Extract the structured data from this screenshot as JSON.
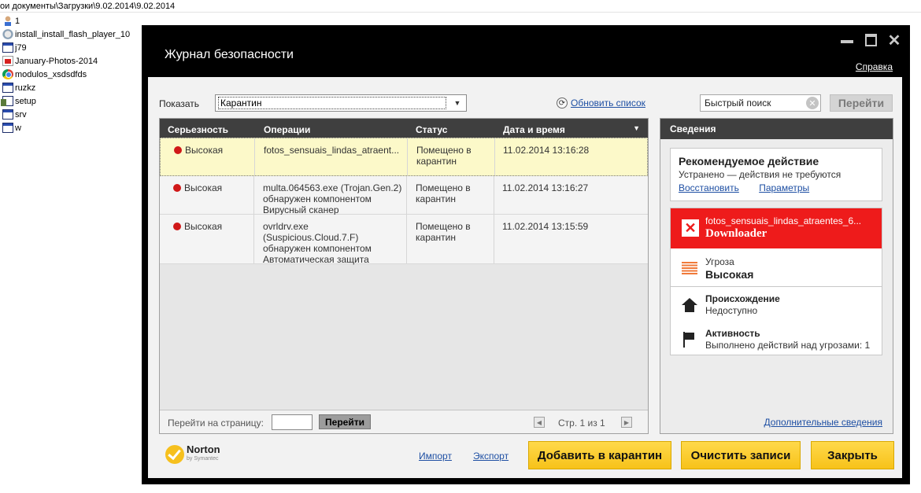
{
  "explorer": {
    "path": "ои документы\\Загрузки\\9.02.2014\\9.02.2014",
    "files": [
      {
        "name": "1",
        "icon": "user-icon"
      },
      {
        "name": "install_install_flash_player_10",
        "icon": "flash-icon"
      },
      {
        "name": "j79",
        "icon": "window-icon"
      },
      {
        "name": "January-Photos-2014",
        "icon": "pdf-icon"
      },
      {
        "name": "modulos_xsdsdfds",
        "icon": "chrome-icon"
      },
      {
        "name": "ruzkz",
        "icon": "window-icon"
      },
      {
        "name": "setup",
        "icon": "setup-icon"
      },
      {
        "name": "srv",
        "icon": "window-icon"
      },
      {
        "name": "w",
        "icon": "window-icon"
      }
    ]
  },
  "window": {
    "title": "Журнал безопасности",
    "help": "Справка"
  },
  "toolbar": {
    "show_label": "Показать",
    "show_value": "Карантин",
    "refresh": "Обновить список",
    "search_placeholder": "Быстрый поиск",
    "go": "Перейти"
  },
  "table": {
    "headers": [
      "Серьезность",
      "Операции",
      "Статус",
      "Дата и время"
    ],
    "rows": [
      {
        "severity": "Высокая",
        "operation": "fotos_sensuais_lindas_atraent...",
        "status": "Помещено в карантин",
        "datetime": "11.02.2014 13:16:28"
      },
      {
        "severity": "Высокая",
        "operation": "multa.064563.exe (Trojan.Gen.2) обнаружен компонентом Вирусный сканер",
        "status": "Помещено в карантин",
        "datetime": "11.02.2014 13:16:27"
      },
      {
        "severity": "Высокая",
        "operation": "ovrldrv.exe (Suspicious.Cloud.7.F) обнаружен компонентом Автоматическая защита",
        "status": "Помещено в карантин",
        "datetime": "11.02.2014 13:15:59"
      }
    ],
    "pager": {
      "label": "Перейти на страницу:",
      "go": "Перейти",
      "page_text": "Стр. 1 из 1"
    }
  },
  "details": {
    "header": "Сведения",
    "recommended_title": "Рекомендуемое действие",
    "recommended_sub": "Устранено — действия не требуются",
    "restore": "Восстановить",
    "params": "Параметры",
    "threat_file": "fotos_sensuais_lindas_atraentes_6...",
    "threat_name": "Downloader",
    "severity_label": "Угроза",
    "severity_value": "Высокая",
    "origin_label": "Происхождение",
    "origin_value": "Недоступно",
    "activity_label": "Активность",
    "activity_value": "Выполнено действий над угрозами: 1",
    "more": "Дополнительные сведения"
  },
  "footer": {
    "logo": "Norton",
    "logo_sub": "by Symantec",
    "import": "Импорт",
    "export": "Экспорт",
    "quarantine": "Добавить в карантин",
    "clear": "Очистить записи",
    "close": "Закрыть"
  },
  "colors": {
    "accent_yellow": "#f7c21a",
    "threat_red": "#ee1b1b",
    "highlight_row": "#fcf9c9",
    "link_blue": "#1e4fa3"
  }
}
